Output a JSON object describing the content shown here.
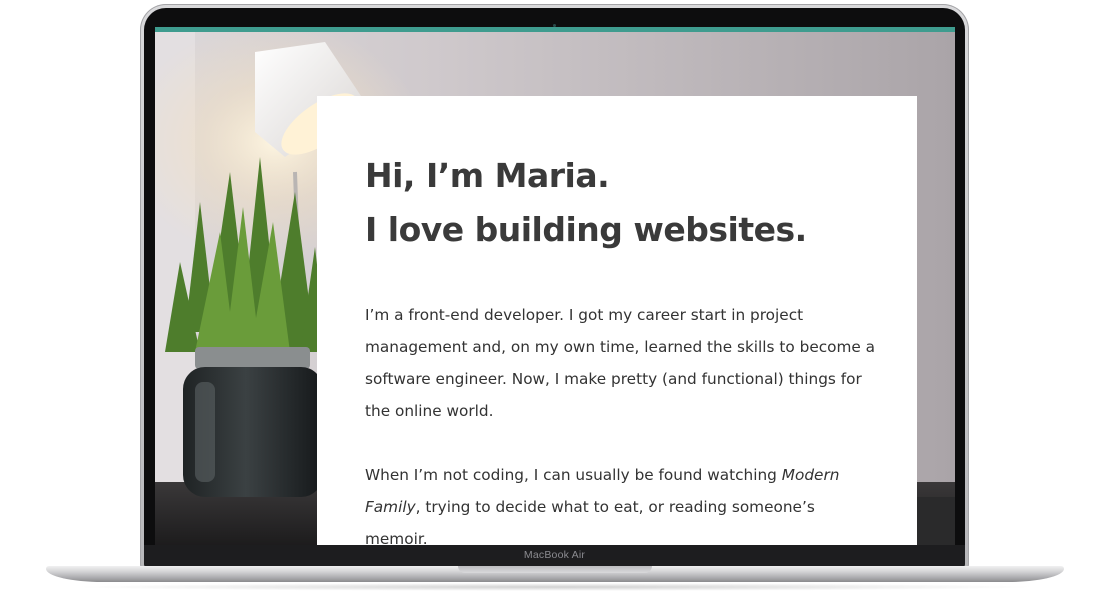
{
  "device": {
    "brand_label": "MacBook Air"
  },
  "colors": {
    "accent": "#3f9c8f",
    "heading": "#3a3a3a",
    "body_text": "#333333",
    "card_background": "#ffffff"
  },
  "hero": {
    "greeting": "Hi, I’m Maria.",
    "tagline": "I love building websites.",
    "bio_paragraph_1": "I’m a front-end developer. I got my career start in project management and, on my own time, learned the skills to become a software engineer. Now, I make pretty (and functional) things for the online world.",
    "bio_paragraph_2_prefix": "When I’m not coding, I can usually be found watching ",
    "bio_paragraph_2_emphasis": "Modern Family",
    "bio_paragraph_2_suffix": ", trying to decide what to eat, or reading someone’s memoir."
  },
  "background_image": {
    "description_icon": "plant-and-lamp-photo"
  }
}
